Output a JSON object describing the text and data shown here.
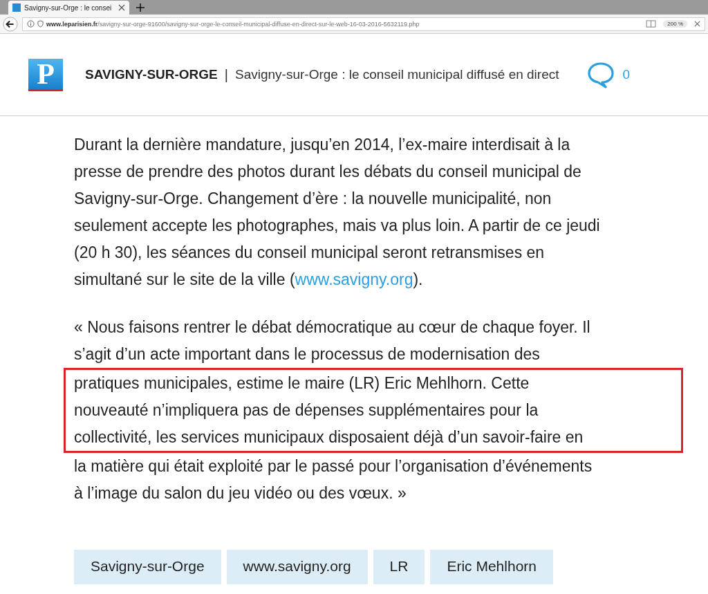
{
  "browser": {
    "tab": {
      "title": "Savigny-sur-Orge : le consei"
    },
    "url": {
      "domain": "www.leparisien.fr",
      "path": "/savigny-sur-orge-91600/savigny-sur-orge-le-conseil-municipal-diffuse-en-direct-sur-le-web-16-03-2016-5632119.php"
    },
    "zoom": "200 %"
  },
  "header": {
    "logo_letter": "P",
    "section": "SAVIGNY-SUR-ORGE",
    "separator": "|",
    "title": "Savigny-sur-Orge : le conseil municipal diffusé en direct",
    "comments": "0"
  },
  "paragraphs": [
    {
      "lines": [
        "Durant la dernière mandature, jusqu’en 2014, l’ex-maire interdisait à la",
        "presse de prendre des photos durant les débats du conseil municipal de",
        "Savigny-sur-Orge. Changement d’ère : la nouvelle municipalité, non",
        "seulement accepte les photographes, mais va plus loin. A partir de ce jeudi",
        "(20 h 30), les séances du conseil municipal seront retransmises en"
      ],
      "last_line": {
        "before": "simultané sur le site de la ville (",
        "link": "www.savigny.org",
        "after": ")."
      }
    },
    {
      "lines": [
        "« Nous faisons rentrer le débat démocratique au cœur de chaque foyer. Il",
        "s’agit d’un acte important dans le processus de modernisation des"
      ],
      "highlighted_lines": [
        "pratiques municipales, estime le maire (LR) Eric Mehlhorn. Cette",
        "nouveauté n’impliquera pas de dépenses supplémentaires pour la",
        "collectivité, les services municipaux disposaient déjà d’un savoir-faire en"
      ],
      "after_lines": [
        "la matière qui était exploité par le passé pour l’organisation d’événements",
        "à l’image du salon du jeu vidéo ou des vœux. »"
      ]
    }
  ],
  "tags": [
    "Savigny-sur-Orge",
    "www.savigny.org",
    "LR",
    "Eric Mehlhorn"
  ]
}
